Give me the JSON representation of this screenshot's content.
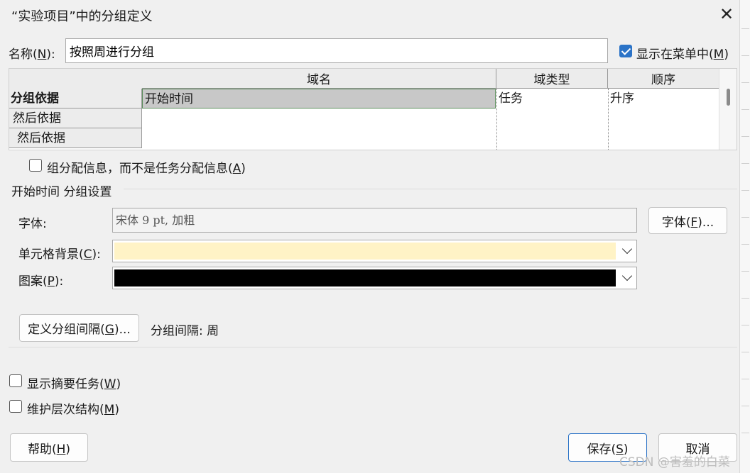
{
  "dialog": {
    "title": "“实验项目”中的分组定义",
    "close_glyph": "✕"
  },
  "name": {
    "label_prefix": "名称(",
    "label_key": "N",
    "label_suffix": "):",
    "value": "按照周进行分组"
  },
  "show_in_menu": {
    "checked": true,
    "label_prefix": "显示在菜单中(",
    "label_key": "M",
    "label_suffix": ")"
  },
  "grid": {
    "columns": [
      "域名",
      "域类型",
      "顺序"
    ],
    "rows": [
      {
        "header": "分组依据",
        "field": "开始时间",
        "type": "任务",
        "order": "升序"
      },
      {
        "header": "然后依据",
        "field": "",
        "type": "",
        "order": ""
      },
      {
        "header": "然后依据",
        "field": "",
        "type": "",
        "order": ""
      }
    ]
  },
  "group_assign": {
    "checked": false,
    "label_prefix": "组分配信息，而不是任务分配信息(",
    "label_key": "A",
    "label_suffix": ")"
  },
  "settings_section_title": "开始时间 分组设置",
  "font": {
    "label": "字体:",
    "value": "宋体 9 pt, 加粗",
    "button_prefix": "字体(",
    "button_key": "F",
    "button_suffix": ")..."
  },
  "cell_background": {
    "label_prefix": "单元格背景(",
    "label_key": "C",
    "label_suffix": "):",
    "color": "#fff3c6"
  },
  "pattern": {
    "label_prefix": "图案(",
    "label_key": "P",
    "label_suffix": "):",
    "color": "#000000"
  },
  "interval": {
    "button_prefix": "定义分组间隔(",
    "button_key": "G",
    "button_suffix": ")...",
    "text": "分组间隔: 周"
  },
  "show_summary": {
    "checked": false,
    "label_prefix": "显示摘要任务(",
    "label_key": "W",
    "label_suffix": ")"
  },
  "keep_hierarchy": {
    "checked": false,
    "label_prefix": "维护层次结构(",
    "label_key": "M",
    "label_suffix": ")"
  },
  "buttons": {
    "help_prefix": "帮助(",
    "help_key": "H",
    "help_suffix": ")",
    "save_prefix": "保存(",
    "save_key": "S",
    "save_suffix": ")",
    "cancel": "取消"
  },
  "watermark": "CSDN @害羞的白菜",
  "colors": {
    "accent": "#2b73c7",
    "selected_cell": "#c8c8c8",
    "dialog_bg": "#f0f0f0"
  }
}
